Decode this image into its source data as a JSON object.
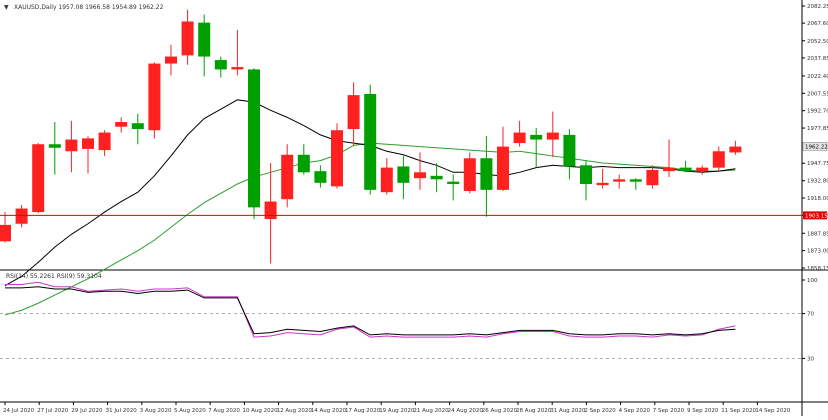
{
  "window": {
    "symbol_header": "XAUUSD,Daily  1957.08 1966.58 1954.89 1962.22",
    "rsi_header": "RSI(14) 55.2261  RSI(9) 59.3104"
  },
  "colors": {
    "bull": "#00a000",
    "bear": "#ff2020",
    "ma_fast": "#000000",
    "ma_slow": "#2e9e2e",
    "hline": "#e00000",
    "rsi_primary": "#000000",
    "rsi_secondary": "#cc33cc",
    "price_badge": "#e6e6e6"
  },
  "chart_data": [
    {
      "type": "candlestick",
      "title": "XAUUSD,Daily",
      "ylim": [
        1858.15,
        2082.25
      ],
      "y_ticks": [
        "2082.25",
        "2067.60",
        "2052.50",
        "2037.85",
        "2022.40",
        "2007.55",
        "1992.70",
        "1977.85",
        "1962.22",
        "1947.75",
        "1932.80",
        "1918.00",
        "1903.15",
        "1887.85",
        "1873.00",
        "1858.15"
      ],
      "current_price_label": "1962.22",
      "hline_value": 1903.15,
      "hline_label": "1903.15",
      "x_tick_labels": [
        "24 Jul 2020",
        "27 Jul 2020",
        "29 Jul 2020",
        "31 Jul 2020",
        "3 Aug 2020",
        "5 Aug 2020",
        "7 Aug 2020",
        "10 Aug 2020",
        "12 Aug 2020",
        "14 Aug 2020",
        "17 Aug 2020",
        "19 Aug 2020",
        "21 Aug 2020",
        "24 Aug 2020",
        "26 Aug 2020",
        "28 Aug 2020",
        "31 Aug 2020",
        "2 Sep 2020",
        "4 Sep 2020",
        "7 Sep 2020",
        "9 Sep 2020",
        "11 Sep 2020",
        "14 Sep 2020"
      ],
      "candles": [
        {
          "o": 1881,
          "h": 1906,
          "l": 1880,
          "c": 1895
        },
        {
          "o": 1896,
          "h": 1912,
          "l": 1893,
          "c": 1909
        },
        {
          "o": 1906,
          "h": 1965,
          "l": 1905,
          "c": 1964
        },
        {
          "o": 1964,
          "h": 1983,
          "l": 1938,
          "c": 1961
        },
        {
          "o": 1958,
          "h": 1984,
          "l": 1940,
          "c": 1968
        },
        {
          "o": 1960,
          "h": 1971,
          "l": 1939,
          "c": 1969
        },
        {
          "o": 1959,
          "h": 1976,
          "l": 1954,
          "c": 1974
        },
        {
          "o": 1979,
          "h": 1987,
          "l": 1974,
          "c": 1983
        },
        {
          "o": 1982,
          "h": 1990,
          "l": 1964,
          "c": 1977
        },
        {
          "o": 1976,
          "h": 2034,
          "l": 1969,
          "c": 2033
        },
        {
          "o": 2033,
          "h": 2049,
          "l": 2023,
          "c": 2039
        },
        {
          "o": 2040,
          "h": 2079,
          "l": 2032,
          "c": 2069
        },
        {
          "o": 2068,
          "h": 2075,
          "l": 2022,
          "c": 2039
        },
        {
          "o": 2036,
          "h": 2039,
          "l": 2021,
          "c": 2028
        },
        {
          "o": 2028,
          "h": 2062,
          "l": 2023,
          "c": 2030
        },
        {
          "o": 2028,
          "h": 2029,
          "l": 1900,
          "c": 1910
        },
        {
          "o": 1900,
          "h": 1948,
          "l": 1862,
          "c": 1915
        },
        {
          "o": 1917,
          "h": 1964,
          "l": 1910,
          "c": 1955
        },
        {
          "o": 1955,
          "h": 1964,
          "l": 1938,
          "c": 1940
        },
        {
          "o": 1941,
          "h": 1946,
          "l": 1927,
          "c": 1931
        },
        {
          "o": 1928,
          "h": 1982,
          "l": 1926,
          "c": 1976
        },
        {
          "o": 1977,
          "h": 2017,
          "l": 1963,
          "c": 2006
        },
        {
          "o": 2007,
          "h": 2015,
          "l": 1921,
          "c": 1925
        },
        {
          "o": 1923,
          "h": 1952,
          "l": 1921,
          "c": 1944
        },
        {
          "o": 1945,
          "h": 1954,
          "l": 1917,
          "c": 1931
        },
        {
          "o": 1935,
          "h": 1957,
          "l": 1925,
          "c": 1940
        },
        {
          "o": 1937,
          "h": 1948,
          "l": 1923,
          "c": 1934
        },
        {
          "o": 1932,
          "h": 1938,
          "l": 1916,
          "c": 1930
        },
        {
          "o": 1924,
          "h": 1957,
          "l": 1922,
          "c": 1952
        },
        {
          "o": 1952,
          "h": 1971,
          "l": 1902,
          "c": 1925
        },
        {
          "o": 1925,
          "h": 1979,
          "l": 1924,
          "c": 1962
        },
        {
          "o": 1965,
          "h": 1984,
          "l": 1962,
          "c": 1974
        },
        {
          "o": 1972,
          "h": 1978,
          "l": 1944,
          "c": 1968
        },
        {
          "o": 1968,
          "h": 1992,
          "l": 1953,
          "c": 1974
        },
        {
          "o": 1972,
          "h": 1977,
          "l": 1934,
          "c": 1945
        },
        {
          "o": 1946,
          "h": 1950,
          "l": 1916,
          "c": 1930
        },
        {
          "o": 1929,
          "h": 1943,
          "l": 1926,
          "c": 1931
        },
        {
          "o": 1932,
          "h": 1938,
          "l": 1926,
          "c": 1934
        },
        {
          "o": 1934,
          "h": 1935,
          "l": 1925,
          "c": 1932
        },
        {
          "o": 1929,
          "h": 1946,
          "l": 1926,
          "c": 1942
        },
        {
          "o": 1941,
          "h": 1968,
          "l": 1936,
          "c": 1944
        },
        {
          "o": 1944,
          "h": 1950,
          "l": 1940,
          "c": 1941
        },
        {
          "o": 1941,
          "h": 1946,
          "l": 1938,
          "c": 1944
        },
        {
          "o": 1944,
          "h": 1962,
          "l": 1941,
          "c": 1958
        },
        {
          "o": 1957,
          "h": 1967,
          "l": 1955,
          "c": 1962
        }
      ],
      "ma_fast": [
        1843,
        1851,
        1863,
        1876,
        1887,
        1896,
        1906,
        1915,
        1923,
        1937,
        1954,
        1972,
        1986,
        1994,
        2002,
        2000,
        1993,
        1987,
        1980,
        1972,
        1967,
        1965,
        1963,
        1958,
        1955,
        1950,
        1946,
        1940,
        1940,
        1938,
        1937,
        1940,
        1944,
        1946,
        1945,
        1944,
        1945,
        1944,
        1944,
        1944,
        1943,
        1941,
        1940,
        1941,
        1943
      ],
      "ma_slow": [
        1818,
        1822,
        1828,
        1835,
        1842,
        1849,
        1857,
        1865,
        1873,
        1882,
        1893,
        1904,
        1914,
        1922,
        1930,
        1936,
        1940,
        1944,
        1948,
        1950,
        1955,
        1963,
        1965,
        1964,
        1963,
        1962,
        1961,
        1960,
        1959,
        1958,
        1957,
        1958,
        1956,
        1954,
        1952,
        1950,
        1948,
        1947,
        1946,
        1945,
        1944,
        1942,
        1941,
        1941,
        1942
      ]
    },
    {
      "type": "line",
      "title": "RSI(14) 55.2261  RSI(9) 59.3104",
      "ylim": [
        0,
        100
      ],
      "y_ticks": [
        "100",
        "70",
        "30"
      ],
      "levels": [
        70,
        30
      ],
      "series": [
        {
          "name": "RSI(14)",
          "values": [
            93,
            93,
            94,
            92,
            92,
            89,
            90,
            90,
            88,
            90,
            90,
            91,
            84,
            84,
            84,
            52,
            53,
            56,
            55,
            54,
            57,
            59,
            51,
            52,
            51,
            51,
            51,
            51,
            52,
            51,
            53,
            55,
            55,
            55,
            52,
            51,
            51,
            52,
            52,
            51,
            52,
            51,
            52,
            55,
            56
          ]
        },
        {
          "name": "RSI(9)",
          "values": [
            96,
            96,
            98,
            94,
            94,
            90,
            91,
            92,
            90,
            92,
            92,
            93,
            85,
            85,
            85,
            49,
            50,
            53,
            52,
            51,
            56,
            58,
            49,
            50,
            49,
            49,
            49,
            49,
            50,
            49,
            52,
            54,
            54,
            54,
            50,
            49,
            49,
            50,
            50,
            49,
            51,
            50,
            51,
            56,
            59
          ]
        }
      ]
    }
  ]
}
